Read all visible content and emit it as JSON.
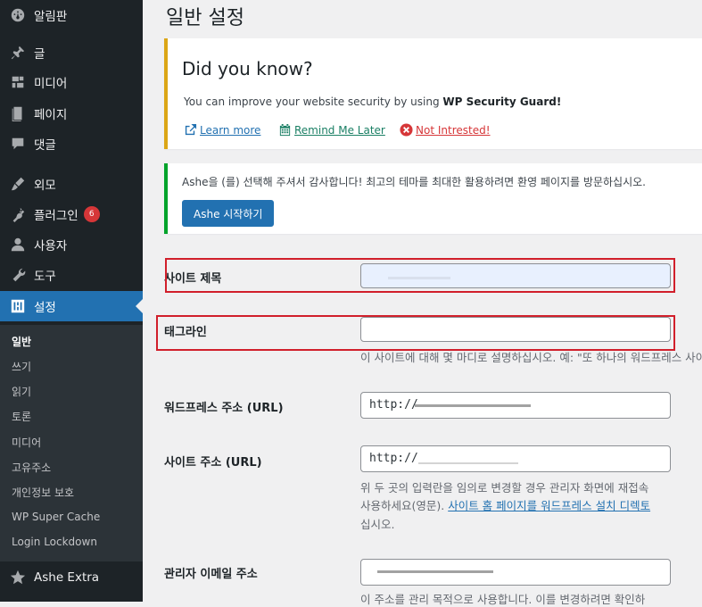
{
  "sidebar": {
    "items": [
      {
        "label": "알림판",
        "icon": "dashboard-icon"
      },
      {
        "label": "글",
        "icon": "pin-icon"
      },
      {
        "label": "미디어",
        "icon": "media-icon"
      },
      {
        "label": "페이지",
        "icon": "page-icon"
      },
      {
        "label": "댓글",
        "icon": "comment-icon"
      },
      {
        "label": "외모",
        "icon": "brush-icon"
      },
      {
        "label": "플러그인",
        "icon": "plugin-icon",
        "badge": "6"
      },
      {
        "label": "사용자",
        "icon": "user-icon"
      },
      {
        "label": "도구",
        "icon": "wrench-icon"
      },
      {
        "label": "설정",
        "icon": "settings-icon",
        "active": true
      },
      {
        "label": "Ashe Extra",
        "icon": "star-icon"
      }
    ],
    "submenu": [
      "일반",
      "쓰기",
      "읽기",
      "토론",
      "미디어",
      "고유주소",
      "개인정보 보호",
      "WP Super Cache",
      "Login Lockdown"
    ]
  },
  "page": {
    "title": "일반 설정"
  },
  "notice_dyk": {
    "title": "Did you know?",
    "desc_prefix": "You can improve your website security by using ",
    "desc_bold": "WP Security Guard!",
    "links": {
      "learn": "Learn more",
      "remind": "Remind Me Later",
      "not_interested": "Not Intrested!"
    },
    "colors": {
      "learn": "#2271b1",
      "remind": "#1a7f64",
      "not_interested": "#d63638"
    }
  },
  "notice_ashe": {
    "message": "Ashe을 (를) 선택해 주셔서 감사합니다! 최고의 테마를 최대한 활용하려면 환영 페이지를 방문하십시오.",
    "button": "Ashe 시작하기"
  },
  "form": {
    "site_title": {
      "label": "사이트 제목",
      "value": ""
    },
    "tagline": {
      "label": "태그라인",
      "value": "",
      "desc": "이 사이트에 대해 몇 마디로 설명하십시오. 예: \"또 하나의 워드프레스 사이트\""
    },
    "wp_url": {
      "label": "워드프레스 주소 (URL)",
      "value": "http://"
    },
    "site_url": {
      "label": "사이트 주소 (URL)",
      "value": "http://",
      "desc_line1": "위 두 곳의 입력란을 임의로 변경할 경우 관리자 화면에 재접속",
      "desc_line2_prefix": "사용하세요(영문). ",
      "desc_line2_link": "사이트 홈 페이지를 워드프레스 설치 디렉토",
      "desc_line3": "십시오."
    },
    "admin_email": {
      "label": "관리자 이메일 주소",
      "desc": "이 주소를 관리 목적으로 사용합니다. 이를 변경하려면 확인하"
    }
  },
  "colors": {
    "sidebar_bg": "#1d2327",
    "accent": "#2271b1",
    "warning": "#dba617",
    "success": "#00a32a",
    "highlight_box": "#d11f2b"
  }
}
